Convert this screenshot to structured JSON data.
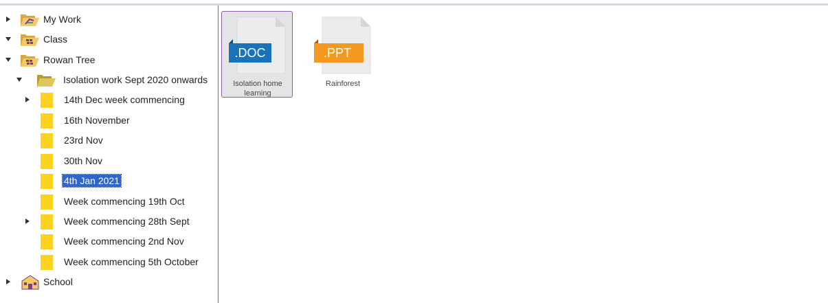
{
  "tree": {
    "items": [
      {
        "label": "My Work",
        "icon": "my-work-folder-icon",
        "expander": "collapsed",
        "selected": false
      },
      {
        "label": "Class",
        "icon": "class-folder-icon",
        "expander": "expanded",
        "selected": false
      },
      {
        "label": "Rowan Tree",
        "icon": "class-folder-icon",
        "expander": "expanded",
        "selected": false
      },
      {
        "label": "Isolation work Sept 2020 onwards",
        "icon": "open-folder-icon",
        "expander": "expanded",
        "selected": false
      },
      {
        "label": "14th Dec week commencing",
        "icon": "folder-icon",
        "expander": "collapsed",
        "selected": false
      },
      {
        "label": "16th November",
        "icon": "folder-icon",
        "expander": "none",
        "selected": false
      },
      {
        "label": "23rd Nov",
        "icon": "folder-icon",
        "expander": "none",
        "selected": false
      },
      {
        "label": "30th Nov",
        "icon": "folder-icon",
        "expander": "none",
        "selected": false
      },
      {
        "label": "4th Jan 2021",
        "icon": "folder-icon",
        "expander": "none",
        "selected": true
      },
      {
        "label": "Week commencing 19th Oct",
        "icon": "folder-icon",
        "expander": "none",
        "selected": false
      },
      {
        "label": "Week commencing 28th Sept",
        "icon": "folder-icon",
        "expander": "collapsed",
        "selected": false
      },
      {
        "label": "Week commencing 2nd Nov",
        "icon": "folder-icon",
        "expander": "none",
        "selected": false
      },
      {
        "label": "Week commencing 5th October",
        "icon": "folder-icon",
        "expander": "none",
        "selected": false
      },
      {
        "label": "School",
        "icon": "school-icon",
        "expander": "collapsed",
        "selected": false
      }
    ]
  },
  "files": [
    {
      "name": "Isolation home learning",
      "badge": ".DOC",
      "badge_color": "#1a73b8",
      "selected": true,
      "icon": "doc-file-icon"
    },
    {
      "name": "Rainforest",
      "badge": ".PPT",
      "badge_color": "#f39a1e",
      "selected": false,
      "icon": "ppt-file-icon"
    }
  ],
  "colors": {
    "accent": "#8a5ca6",
    "selection": "#2e67c8",
    "folder": "#ffd21f"
  }
}
